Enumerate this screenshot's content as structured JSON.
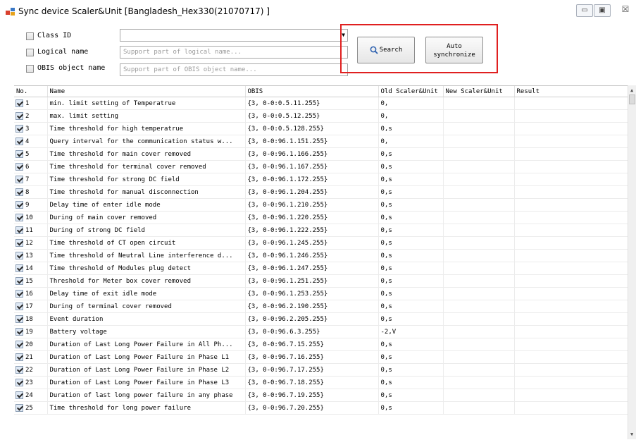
{
  "window": {
    "title": "Sync device Scaler&Unit  [Bangladesh_Hex330(21070717) ]",
    "minimize_label": "▭",
    "maximize_label": "▣",
    "close_label": "☒"
  },
  "filters": {
    "class_id_label": "Class ID",
    "class_id_value": "",
    "logical_name_label": "Logical name",
    "logical_name_placeholder": "Support part of logical name...",
    "obis_label": "OBIS object name",
    "obis_placeholder": "Support part of OBIS object name..."
  },
  "buttons": {
    "search_label": "Search",
    "auto_sync_line1": "Auto",
    "auto_sync_line2": "synchronize"
  },
  "colors": {
    "highlight_border": "#e02020"
  },
  "table": {
    "columns": [
      "No.",
      "Name",
      "OBIS",
      "Old Scaler&Unit",
      "New Scaler&Unit",
      "Result"
    ],
    "rows": [
      {
        "no": "1",
        "name": "min. limit setting of Temperatrue",
        "obis": "{3, 0-0:0.5.11.255}",
        "old": "0,",
        "new": "",
        "result": ""
      },
      {
        "no": "2",
        "name": "max. limit setting",
        "obis": "{3, 0-0:0.5.12.255}",
        "old": "0,",
        "new": "",
        "result": ""
      },
      {
        "no": "3",
        "name": "Time threshold for high temperatrue",
        "obis": "{3, 0-0:0.5.128.255}",
        "old": "0,s",
        "new": "",
        "result": ""
      },
      {
        "no": "4",
        "name": "Query interval for the communication status w...",
        "obis": "{3, 0-0:96.1.151.255}",
        "old": "0,",
        "new": "",
        "result": ""
      },
      {
        "no": "5",
        "name": "Time threshold for main cover removed",
        "obis": "{3, 0-0:96.1.166.255}",
        "old": "0,s",
        "new": "",
        "result": ""
      },
      {
        "no": "6",
        "name": "Time threshold for terminal cover removed",
        "obis": "{3, 0-0:96.1.167.255}",
        "old": "0,s",
        "new": "",
        "result": ""
      },
      {
        "no": "7",
        "name": "Time threshold for strong DC field",
        "obis": "{3, 0-0:96.1.172.255}",
        "old": "0,s",
        "new": "",
        "result": ""
      },
      {
        "no": "8",
        "name": "Time threshold for manual disconnection",
        "obis": "{3, 0-0:96.1.204.255}",
        "old": "0,s",
        "new": "",
        "result": ""
      },
      {
        "no": "9",
        "name": "Delay time of enter idle mode",
        "obis": "{3, 0-0:96.1.210.255}",
        "old": "0,s",
        "new": "",
        "result": ""
      },
      {
        "no": "10",
        "name": "During of main cover removed",
        "obis": "{3, 0-0:96.1.220.255}",
        "old": "0,s",
        "new": "",
        "result": ""
      },
      {
        "no": "11",
        "name": "During of strong DC field",
        "obis": "{3, 0-0:96.1.222.255}",
        "old": "0,s",
        "new": "",
        "result": ""
      },
      {
        "no": "12",
        "name": "Time threshold of CT open circuit",
        "obis": "{3, 0-0:96.1.245.255}",
        "old": "0,s",
        "new": "",
        "result": ""
      },
      {
        "no": "13",
        "name": "Time threshold of Neutral Line interference d...",
        "obis": "{3, 0-0:96.1.246.255}",
        "old": "0,s",
        "new": "",
        "result": ""
      },
      {
        "no": "14",
        "name": "Time threshold of Modules plug detect",
        "obis": "{3, 0-0:96.1.247.255}",
        "old": "0,s",
        "new": "",
        "result": ""
      },
      {
        "no": "15",
        "name": "Threshold for Meter box cover removed",
        "obis": "{3, 0-0:96.1.251.255}",
        "old": "0,s",
        "new": "",
        "result": ""
      },
      {
        "no": "16",
        "name": "Delay time of  exit idle mode",
        "obis": "{3, 0-0:96.1.253.255}",
        "old": "0,s",
        "new": "",
        "result": ""
      },
      {
        "no": "17",
        "name": "During of terminal cover removed",
        "obis": "{3, 0-0:96.2.190.255}",
        "old": "0,s",
        "new": "",
        "result": ""
      },
      {
        "no": "18",
        "name": "Event duration",
        "obis": "{3, 0-0:96.2.205.255}",
        "old": "0,s",
        "new": "",
        "result": ""
      },
      {
        "no": "19",
        "name": "Battery voltage",
        "obis": "{3, 0-0:96.6.3.255}",
        "old": "-2,V",
        "new": "",
        "result": ""
      },
      {
        "no": "20",
        "name": "Duration of Last Long Power Failure in All Ph...",
        "obis": "{3, 0-0:96.7.15.255}",
        "old": "0,s",
        "new": "",
        "result": ""
      },
      {
        "no": "21",
        "name": "Duration of Last Long Power Failure in Phase L1",
        "obis": "{3, 0-0:96.7.16.255}",
        "old": "0,s",
        "new": "",
        "result": ""
      },
      {
        "no": "22",
        "name": "Duration of Last Long Power Failure in Phase L2",
        "obis": "{3, 0-0:96.7.17.255}",
        "old": "0,s",
        "new": "",
        "result": ""
      },
      {
        "no": "23",
        "name": "Duration of Last Long Power Failure in Phase L3",
        "obis": "{3, 0-0:96.7.18.255}",
        "old": "0,s",
        "new": "",
        "result": ""
      },
      {
        "no": "24",
        "name": "Duration of last long power failure in any phase",
        "obis": "{3, 0-0:96.7.19.255}",
        "old": "0,s",
        "new": "",
        "result": ""
      },
      {
        "no": "25",
        "name": "Time threshold for long power failure",
        "obis": "{3, 0-0:96.7.20.255}",
        "old": "0,s",
        "new": "",
        "result": ""
      }
    ]
  }
}
